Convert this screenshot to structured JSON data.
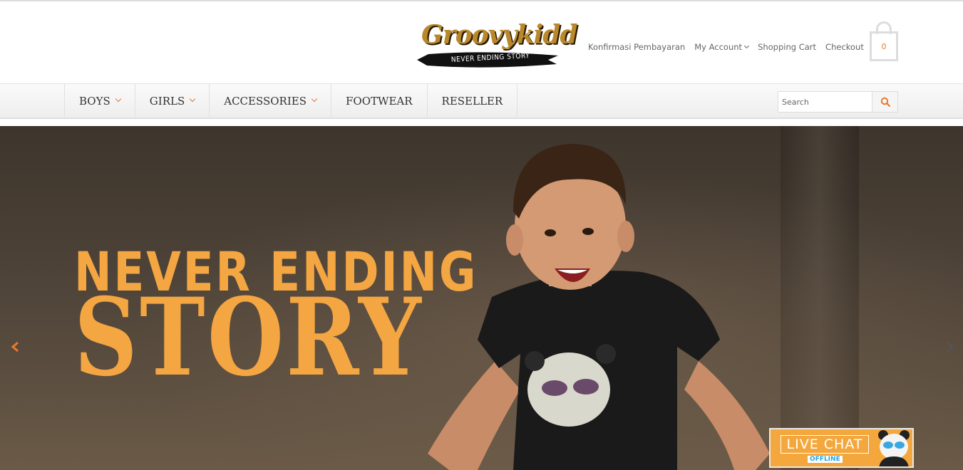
{
  "brand": {
    "name": "Groovykidd",
    "tagline": "NEVER ENDING STORY"
  },
  "toplinks": {
    "confirm_payment": "Konfirmasi Pembayaran",
    "my_account": "My Account",
    "shopping_cart": "Shopping Cart",
    "checkout": "Checkout"
  },
  "cart": {
    "count": "0"
  },
  "nav": {
    "items": [
      {
        "label": "BOYS",
        "has_dropdown": true
      },
      {
        "label": "GIRLS",
        "has_dropdown": true
      },
      {
        "label": "ACCESSORIES",
        "has_dropdown": true
      },
      {
        "label": "FOOTWEAR",
        "has_dropdown": false
      },
      {
        "label": "RESELLER",
        "has_dropdown": false
      }
    ]
  },
  "search": {
    "placeholder": "Search",
    "icon": "search-icon"
  },
  "hero": {
    "title_line1": "NEVER ENDING",
    "title_line2": "STORY",
    "prev_icon": "chevron-left-icon",
    "next_icon": "chevron-right-icon"
  },
  "livechat": {
    "label": "LIVE CHAT",
    "status": "OFFLINE"
  },
  "colors": {
    "accent": "#e8792c",
    "hero_text": "#f3a642",
    "logo_gold": "#b8882b",
    "chat_status": "#2aa3e0"
  }
}
